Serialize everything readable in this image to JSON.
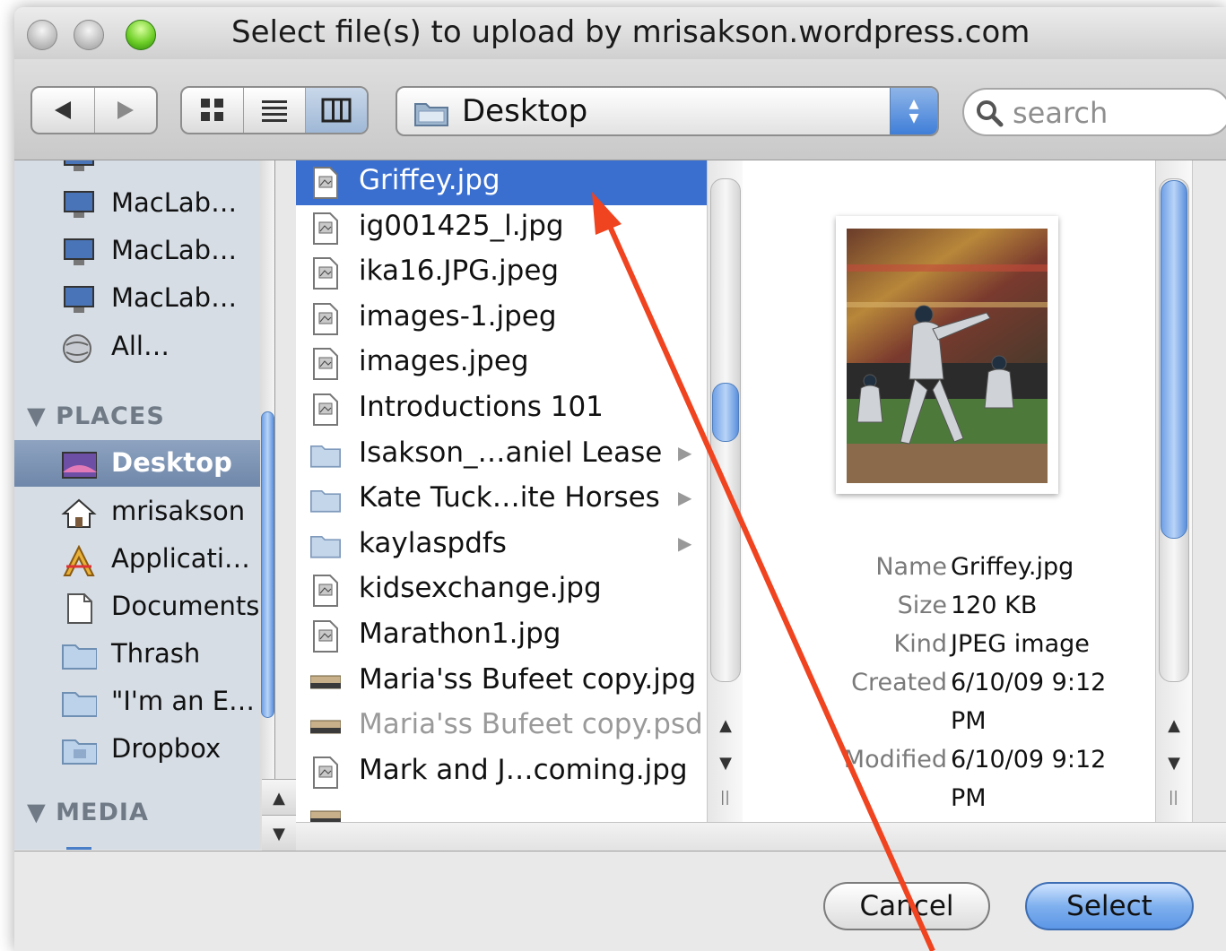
{
  "window": {
    "title": "Select file(s) to upload by mrisakson.wordpress.com"
  },
  "toolbar": {
    "back_icon": "back-arrow-icon",
    "forward_icon": "forward-arrow-icon",
    "view_modes": [
      "icon-view",
      "list-view",
      "column-view"
    ],
    "active_view": "column-view",
    "location": "Desktop",
    "search_placeholder": "search"
  },
  "sidebar": {
    "devices": [
      {
        "label": "MacLab…",
        "icon": "monitor-icon"
      },
      {
        "label": "MacLab…",
        "icon": "monitor-icon"
      },
      {
        "label": "MacLab…",
        "icon": "monitor-icon"
      },
      {
        "label": "All…",
        "icon": "globe-icon"
      }
    ],
    "places_header": "PLACES",
    "places": [
      {
        "label": "Desktop",
        "icon": "desktop-icon",
        "selected": true
      },
      {
        "label": "mrisakson",
        "icon": "home-icon"
      },
      {
        "label": "Applicati…",
        "icon": "applications-icon"
      },
      {
        "label": "Documents",
        "icon": "document-icon"
      },
      {
        "label": "Thrash",
        "icon": "folder-icon"
      },
      {
        "label": "\"I'm an E…",
        "icon": "folder-icon"
      },
      {
        "label": "Dropbox",
        "icon": "dropbox-folder-icon"
      }
    ],
    "media_header": "MEDIA"
  },
  "files": [
    {
      "name": "Griffey.jpg",
      "type": "image",
      "selected": true
    },
    {
      "name": "ig001425_l.jpg",
      "type": "image"
    },
    {
      "name": "ika16.JPG.jpeg",
      "type": "image"
    },
    {
      "name": "images-1.jpeg",
      "type": "image"
    },
    {
      "name": "images.jpeg",
      "type": "image"
    },
    {
      "name": "Introductions 101",
      "type": "image"
    },
    {
      "name": "Isakson_…aniel Lease",
      "type": "folder",
      "has_children": true
    },
    {
      "name": "Kate Tuck…ite Horses",
      "type": "folder",
      "has_children": true
    },
    {
      "name": "kaylaspdfs",
      "type": "folder",
      "has_children": true
    },
    {
      "name": "kidsexchange.jpg",
      "type": "image"
    },
    {
      "name": "Marathon1.jpg",
      "type": "image"
    },
    {
      "name": "Maria'ss Bufeet copy.jpg",
      "type": "thumbnail"
    },
    {
      "name": "Maria'ss Bufeet copy.psd",
      "type": "thumbnail",
      "dimmed": true
    },
    {
      "name": "Mark and J…coming.jpg",
      "type": "image"
    }
  ],
  "preview": {
    "labels": {
      "name": "Name",
      "size": "Size",
      "kind": "Kind",
      "created": "Created",
      "modified": "Modified"
    },
    "name": "Griffey.jpg",
    "size": "120 KB",
    "kind": "JPEG image",
    "created": "6/10/09 9:12",
    "created_time": "PM",
    "modified": "6/10/09 9:12",
    "modified_time": "PM"
  },
  "buttons": {
    "cancel": "Cancel",
    "select": "Select"
  },
  "colors": {
    "selection_blue": "#3a6fd0",
    "sidebar_bg": "#d6dde5",
    "annotation_arrow": "#f0431f",
    "traffic_green": "#6fcf28"
  }
}
